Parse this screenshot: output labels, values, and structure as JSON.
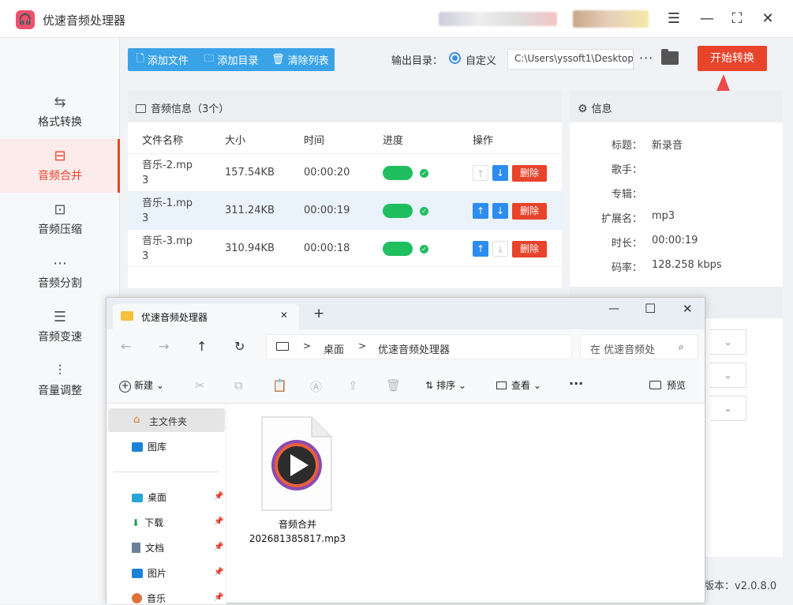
{
  "app": {
    "title": "优速音频处理器",
    "logo_glyph": "🎧",
    "version_label": "版本：v2.0.8.0"
  },
  "window_controls": {
    "menu": "☰",
    "minimize": "—",
    "maximize": "⛶",
    "close": "✕"
  },
  "sidebar": {
    "items": [
      {
        "label": "格式转换",
        "icon": "⇆"
      },
      {
        "label": "音频合并",
        "icon": "⊟"
      },
      {
        "label": "音频压缩",
        "icon": "⊡"
      },
      {
        "label": "音频分割",
        "icon": "⋯"
      },
      {
        "label": "音频变速",
        "icon": "☰"
      },
      {
        "label": "音量调整",
        "icon": "⫶"
      }
    ],
    "active_index": 1
  },
  "toolbar": {
    "add_file": "添加文件",
    "add_dir": "添加目录",
    "clear_list": "清除列表",
    "add_file_icon": "🗋",
    "add_dir_icon": "🗀",
    "clear_icon": "🗑"
  },
  "output": {
    "label": "输出目录：",
    "option": "自定义",
    "path": "C:\\Users\\yssoft1\\Desktop",
    "more": "···"
  },
  "start_button": "开始转换",
  "list": {
    "header": "音频信息（3个）",
    "columns": [
      "文件名称",
      "大小",
      "时间",
      "进度",
      "操作"
    ],
    "rows": [
      {
        "name_l1": "音乐-2.mp",
        "name_l2": "3",
        "size": "157.54KB",
        "time": "00:00:20",
        "progress": 1.0,
        "up_enabled": false,
        "down_enabled": true
      },
      {
        "name_l1": "音乐-1.mp",
        "name_l2": "3",
        "size": "311.24KB",
        "time": "00:00:19",
        "progress": 1.0,
        "up_enabled": true,
        "down_enabled": true
      },
      {
        "name_l1": "音乐-3.mp",
        "name_l2": "3",
        "size": "310.94KB",
        "time": "00:00:18",
        "progress": 1.0,
        "up_enabled": true,
        "down_enabled": false
      }
    ],
    "delete_label": "删除",
    "up_arrow": "↑",
    "down_arrow": "↓",
    "check": "✓"
  },
  "info": {
    "header": "信息",
    "fields": [
      {
        "label": "标题：",
        "value": "新录音"
      },
      {
        "label": "歌手：",
        "value": ""
      },
      {
        "label": "专辑：",
        "value": ""
      },
      {
        "label": "扩展名：",
        "value": "mp3"
      },
      {
        "label": "时长：",
        "value": "00:00:19"
      },
      {
        "label": "码率：",
        "value": "128.258 kbps"
      }
    ],
    "dropdown_chevron": "⌄"
  },
  "explorer": {
    "tab_title": "优速音频处理器",
    "tab_close": "✕",
    "new_tab": "+",
    "win_min": "—",
    "win_max": "☐",
    "win_close": "✕",
    "nav": {
      "back": "←",
      "forward": "→",
      "up": "↑",
      "refresh": "↻"
    },
    "breadcrumb": [
      "桌面",
      "优速音频处理器"
    ],
    "breadcrumb_sep": ">",
    "search_placeholder": "在 优速音频处",
    "commands": {
      "new": "新建",
      "sort": "排序",
      "view": "查看",
      "more": "···",
      "preview": "预览"
    },
    "sidebar": [
      {
        "label": "主文件夹",
        "pinned": false
      },
      {
        "label": "图库",
        "pinned": false
      },
      {
        "label": "桌面",
        "pinned": true
      },
      {
        "label": "下载",
        "pinned": true
      },
      {
        "label": "文档",
        "pinned": true
      },
      {
        "label": "图片",
        "pinned": true
      },
      {
        "label": "音乐",
        "pinned": true
      }
    ],
    "file": {
      "name_l1": "音频合并",
      "name_l2": "202681385817.mp3"
    }
  },
  "colors": {
    "accent": "#e8432b",
    "blue": "#3aa3e8",
    "progress": "#1fbf60"
  }
}
